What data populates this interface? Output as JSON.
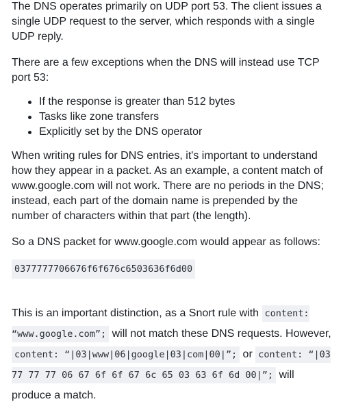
{
  "paragraphs": {
    "p1": "The DNS operates primarily on UDP port 53. The client issues a single UDP request to the server, which responds with a single UDP reply.",
    "p2": "There are a few exceptions when the DNS will instead use TCP port 53:",
    "p3": "When writing rules for DNS entries, it's important to understand how they appear in a packet. As an example, a content match of www.google.com will not work. There are no periods in the DNS; instead, each part of the domain name is prepended by the number of characters within that part (the length).",
    "p4": "So a DNS packet for www.google.com would appear as follows:"
  },
  "exceptions": [
    "If the response is greater than 512 bytes",
    "Tasks like zone transfers",
    "Explicitly set by the DNS operator"
  ],
  "hex_code": "0377777706676f6f676c6503636f6d00",
  "final": {
    "t1": "This is an important distinction, as a Snort rule with ",
    "code1": "content: “www.google.com”;",
    "t2": " will not match these DNS requests. However, ",
    "code2": "content: “|03|www|06|google|03|com|00|”;",
    "t3": " or ",
    "code3": "content: “|03 77 77 77 06 67 6f 6f 67 6c 65 03 63 6f 6d 00|”;",
    "t4": " will produce a match."
  }
}
